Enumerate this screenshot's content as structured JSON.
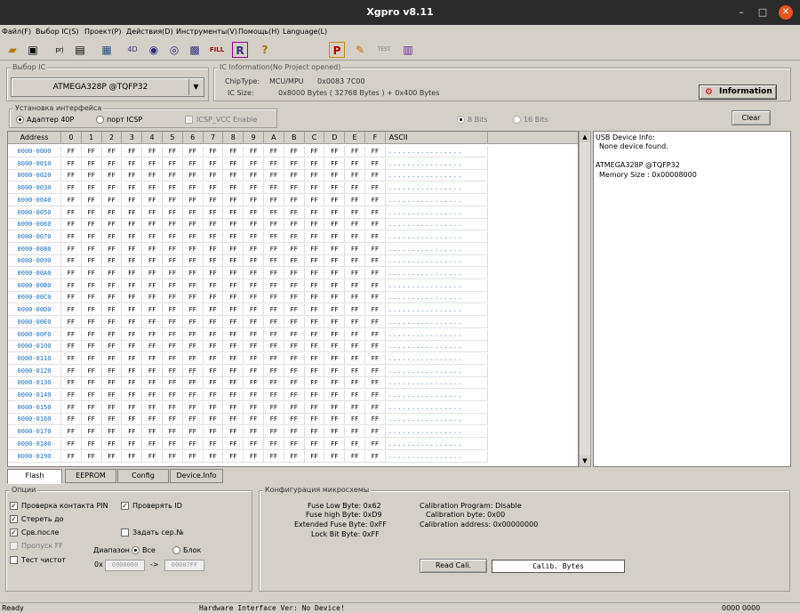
{
  "window": {
    "title": "Xgpro v8.11",
    "minimize": "–",
    "maximize": "□",
    "close": "✕"
  },
  "menu": [
    "Файл(F)",
    "Выбор IC(S)",
    "Проект(P)",
    "Действия(D)",
    "Инструменты(V)",
    "Помощь(H)",
    "Language(L)"
  ],
  "toolbar": {
    "icons": [
      "open-folder-icon",
      "save-icon",
      "prj-icon",
      "save-project-icon",
      "chip-icon",
      "4d-icon",
      "read-icon",
      "verify-icon",
      "program-icon",
      "fill-icon",
      "r-icon",
      "help-icon",
      "p-icon",
      "edit-icon",
      "test-icon",
      "chip-pins-icon"
    ],
    "labels": {
      "prj": "prj",
      "fill": "FILL",
      "r": "R",
      "p": "P",
      "test": "TEST",
      "help": "?"
    }
  },
  "ic_select": {
    "title": "Выбор IC",
    "value": "ATMEGA328P @TQFP32"
  },
  "ic_info": {
    "title": "IC Information(No Project opened)",
    "chip_type_label": "ChipType:",
    "chip_type": "MCU/MPU",
    "chip_id": "0x0083 7C00",
    "ic_size_label": "IC Size:",
    "ic_size": "0x8000 Bytes ( 32768 Bytes ) + 0x400 Bytes",
    "information_button": "Information"
  },
  "interface": {
    "title": "Установка интерфейса",
    "adapter": "Адаптер 40P",
    "icsp_port": "порт ICSP",
    "icsp_vcc": "ICSP_VCC Enable",
    "bits8": "8 Bits",
    "bits16": "16 Bits",
    "clear_button": "Clear"
  },
  "hex_grid": {
    "address_header": "Address",
    "columns": [
      "0",
      "1",
      "2",
      "3",
      "4",
      "5",
      "6",
      "7",
      "8",
      "9",
      "A",
      "B",
      "C",
      "D",
      "E",
      "F"
    ],
    "ascii_header": "ASCII",
    "byte_value": "FF",
    "ascii_value": "................",
    "rows": [
      "0000-0000",
      "0000-0010",
      "0000-0020",
      "0000-0030",
      "0000-0040",
      "0000-0050",
      "0000-0060",
      "0000-0070",
      "0000-0080",
      "0000-0090",
      "0000-00A0",
      "0000-00B0",
      "0000-00C0",
      "0000-00D0",
      "0000-00E0",
      "0000-00F0",
      "0000-0100",
      "0000-0110",
      "0000-0120",
      "0000-0130",
      "0000-0140",
      "0000-0150",
      "0000-0160",
      "0000-0170",
      "0000-0180",
      "0000-0190"
    ]
  },
  "usb_info": {
    "line1": "USB Device Info:",
    "line2": "None device found.",
    "line3": "ATMEGA328P @TQFP32",
    "line4": "Memory Size : 0x00008000"
  },
  "tabs": [
    "Flash",
    "EEPROM",
    "Config",
    "Device.Info"
  ],
  "options": {
    "title": "Опции",
    "check_pin": "Проверка контакта PIN",
    "verify_id": "Проверять ID",
    "erase": "Стереть до",
    "compare_after": "Срв.после",
    "set_serial": "Задать сер.№",
    "skip_ff": "Пропуск FF",
    "blank_check": "Тест чистот",
    "range_label": "Диапазон",
    "all": "Все",
    "block": "Блок",
    "hex_prefix": "0x",
    "range_from": "0000000",
    "range_arrow": "->",
    "range_to": "00007FF"
  },
  "config": {
    "title": "Конфигурация микросхемы",
    "fuse_low": "Fuse Low Byte: 0x62",
    "fuse_high": "Fuse high Byte: 0xD9",
    "ext_fuse": "Extended Fuse Byte: 0xFF",
    "lock_bit": "Lock Bit Byte: 0xFF",
    "calib_program": "Calibration Program: Disable",
    "calib_byte": "Calibration byte: 0x00",
    "calib_address": "Calibration address: 0x00000000",
    "read_calib_button": "Read Cali.",
    "calib_bytes": "Calib. Bytes"
  },
  "status": {
    "ready": "Ready",
    "hw_interface": "Hardware Interface Ver: No Device!",
    "counter": "0000 0000"
  }
}
